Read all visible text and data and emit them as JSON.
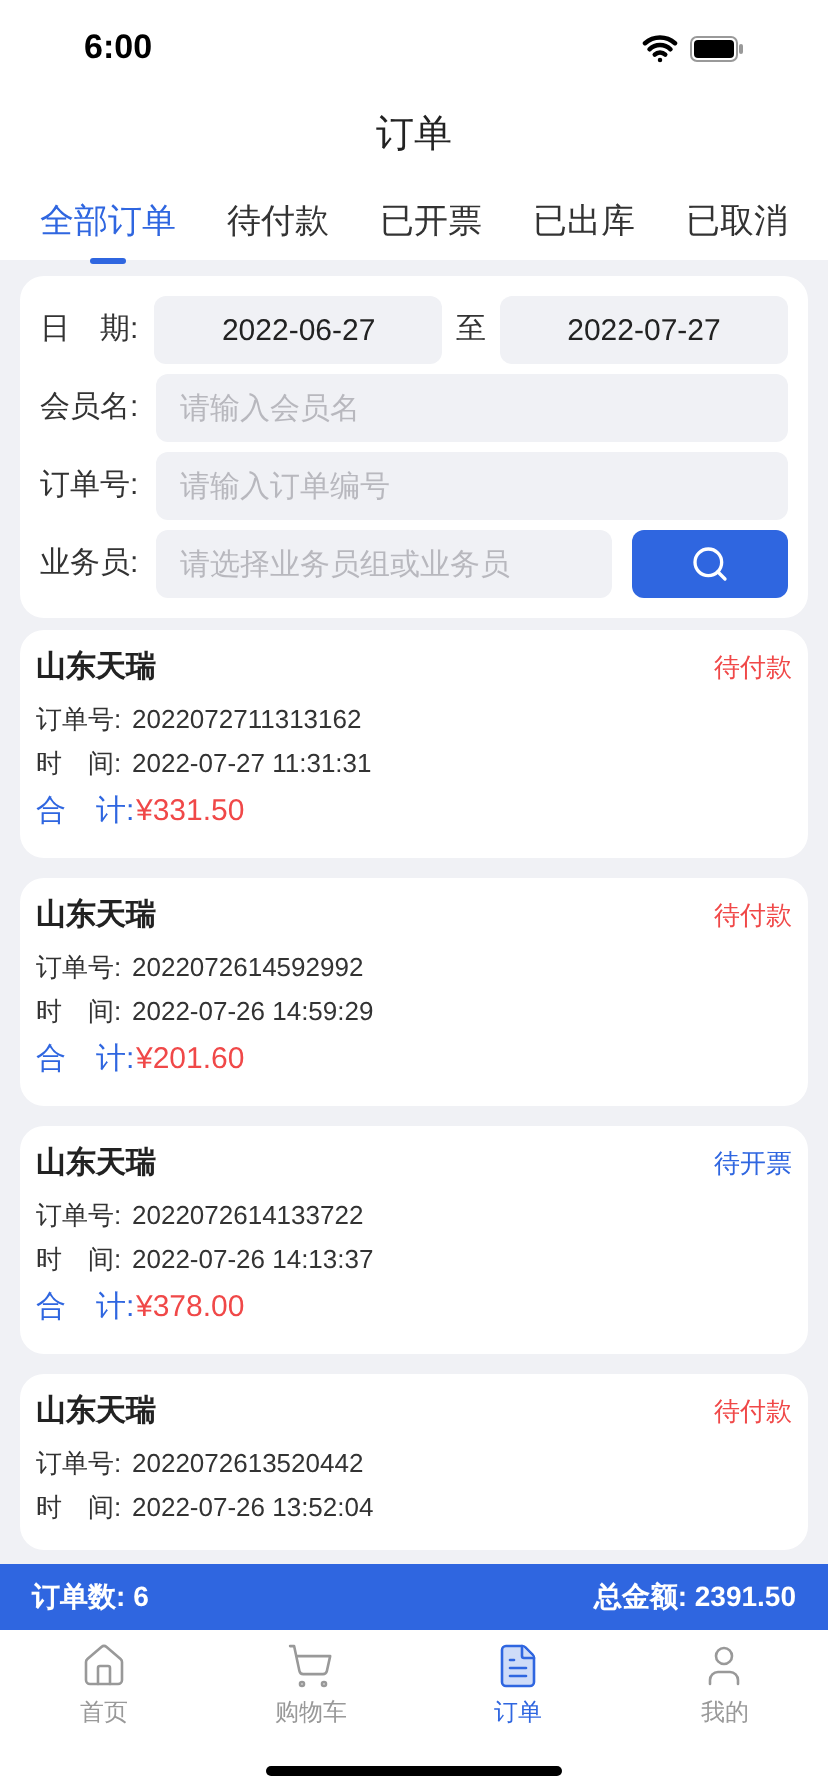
{
  "status_bar": {
    "time": "6:00"
  },
  "title": "订单",
  "tabs": [
    {
      "label": "全部订单",
      "selected": true
    },
    {
      "label": "待付款",
      "selected": false
    },
    {
      "label": "已开票",
      "selected": false
    },
    {
      "label": "已出库",
      "selected": false
    },
    {
      "label": "已取消",
      "selected": false
    }
  ],
  "filters": {
    "date_label": "日　期:",
    "date_from": "2022-06-27",
    "date_sep": "至",
    "date_to": "2022-07-27",
    "member_label": "会员名:",
    "member_placeholder": "请输入会员名",
    "order_label": "订单号:",
    "order_placeholder": "请输入订单编号",
    "staff_label": "业务员:",
    "staff_placeholder": "请选择业务员组或业务员"
  },
  "orders": [
    {
      "customer": "山东天瑞",
      "status": "待付款",
      "color": "#f04848",
      "order_label": "订单号:",
      "order_no": "2022072711313162",
      "time_label": "时　间:",
      "time": "2022-07-27 11:31:31",
      "total_label": "合　计:",
      "total": "¥331.50"
    },
    {
      "customer": "山东天瑞",
      "status": "待付款",
      "color": "#f04848",
      "order_label": "订单号:",
      "order_no": "2022072614592992",
      "time_label": "时　间:",
      "time": "2022-07-26 14:59:29",
      "total_label": "合　计:",
      "total": "¥201.60"
    },
    {
      "customer": "山东天瑞",
      "status": "待开票",
      "color": "#2f66e0",
      "order_label": "订单号:",
      "order_no": "2022072614133722",
      "time_label": "时　间:",
      "time": "2022-07-26 14:13:37",
      "total_label": "合　计:",
      "total": "¥378.00"
    },
    {
      "customer": "山东天瑞",
      "status": "待付款",
      "color": "#f04848",
      "order_label": "订单号:",
      "order_no": "2022072613520442",
      "time_label": "时　间:",
      "time": "2022-07-26 13:52:04"
    }
  ],
  "summary": {
    "count_label": "订单数:",
    "count": "6",
    "amount_label": "总金额:",
    "amount": "2391.50"
  },
  "nav": [
    {
      "label": "首页",
      "selected": false
    },
    {
      "label": "购物车",
      "selected": false
    },
    {
      "label": "订单",
      "selected": true
    },
    {
      "label": "我的",
      "selected": false
    }
  ]
}
